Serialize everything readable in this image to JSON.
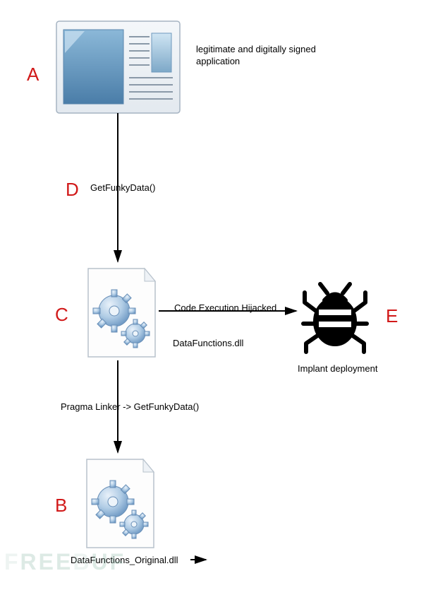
{
  "labels": {
    "A": "A",
    "B": "B",
    "C": "C",
    "D": "D",
    "E": "E"
  },
  "texts": {
    "app_desc": "legitimate and digitally signed application",
    "d_call": "GetFunkyData()",
    "c_hijack": "Code Execution Hijacked",
    "c_dll": "DataFunctions.dll",
    "c_to_b": "Pragma Linker -> GetFunkyData()",
    "e_desc": "Implant deployment",
    "b_dll": "DataFunctions_Original.dll"
  },
  "watermark": "FREEBUF"
}
